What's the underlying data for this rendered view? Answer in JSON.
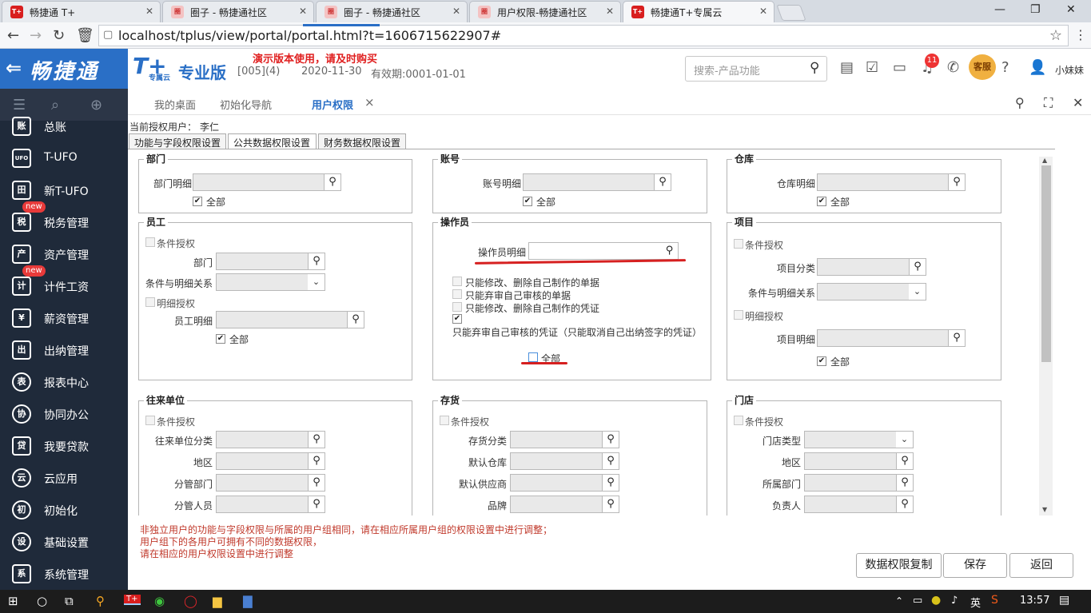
{
  "browser": {
    "tabs": [
      {
        "title": "畅捷通 T+",
        "fav": "T+"
      },
      {
        "title": "圈子 - 畅捷通社区",
        "fav": "圈"
      },
      {
        "title": "圈子 - 畅捷通社区",
        "fav": "圈"
      },
      {
        "title": "用户权限-畅捷通社区",
        "fav": "圈"
      },
      {
        "title": "畅捷通T+专属云",
        "fav": "T+"
      }
    ],
    "url": "localhost/tplus/view/portal/portal.html?t=1606715622907#"
  },
  "header": {
    "brand": "畅捷通",
    "logo": "T+",
    "logo_sub": "专属云",
    "edition": "专业版",
    "account": "[005](4)",
    "demo_notice": "演示版本使用，请及时购买",
    "date": "2020-11-30",
    "valid_until": "有效期:0001-01-01",
    "search_placeholder": "搜索-产品功能",
    "notification_count": "11",
    "mascot_text": "客服",
    "username": "小妹妹"
  },
  "sidebar": {
    "items": [
      {
        "label": "总账",
        "icon": "账"
      },
      {
        "label": "T-UFO",
        "icon": "UFO"
      },
      {
        "label": "新T-UFO",
        "icon": "田"
      },
      {
        "label": "税务管理",
        "icon": "税",
        "badge": "new"
      },
      {
        "label": "资产管理",
        "icon": "产"
      },
      {
        "label": "计件工资",
        "icon": "计",
        "badge": "new"
      },
      {
        "label": "薪资管理",
        "icon": "¥"
      },
      {
        "label": "出纳管理",
        "icon": "出"
      },
      {
        "label": "报表中心",
        "icon": "表"
      },
      {
        "label": "协同办公",
        "icon": "协"
      },
      {
        "label": "我要贷款",
        "icon": "贷"
      },
      {
        "label": "云应用",
        "icon": "云"
      },
      {
        "label": "初始化",
        "icon": "初"
      },
      {
        "label": "基础设置",
        "icon": "设"
      },
      {
        "label": "系统管理",
        "icon": "系"
      }
    ]
  },
  "worktabs": {
    "items": [
      "我的桌面",
      "初始化导航",
      "用户权限"
    ],
    "close": "×"
  },
  "page": {
    "current_user_label": "当前授权用户：",
    "current_user": "李仁",
    "tabs": [
      "功能与字段权限设置",
      "公共数据权限设置",
      "财务数据权限设置"
    ],
    "all": "全部",
    "cond_auth": "条件授权",
    "detail_auth": "明细授权",
    "dept": {
      "title": "部门",
      "detail": "部门明细"
    },
    "account": {
      "title": "账号",
      "detail": "账号明细"
    },
    "warehouse": {
      "title": "仓库",
      "detail": "仓库明细"
    },
    "employee": {
      "title": "员工",
      "dept": "部门",
      "relation": "条件与明细关系",
      "detail": "员工明细"
    },
    "operator": {
      "title": "操作员",
      "detail": "操作员明细",
      "opts": [
        "只能修改、删除自己制作的单据",
        "只能弃审自己审核的单据",
        "只能修改、删除自己制作的凭证",
        "只能弃审自己审核的凭证（只能取消自己出纳签字的凭证）"
      ]
    },
    "project": {
      "title": "项目",
      "category": "项目分类",
      "relation": "条件与明细关系",
      "detail": "项目明细"
    },
    "partner": {
      "title": "往来单位",
      "fields": [
        "往来单位分类",
        "地区",
        "分管部门",
        "分管人员"
      ]
    },
    "inventory": {
      "title": "存货",
      "fields": [
        "存货分类",
        "默认仓库",
        "默认供应商",
        "品牌"
      ]
    },
    "store": {
      "title": "门店",
      "fields": [
        "门店类型",
        "地区",
        "所属部门",
        "负责人"
      ]
    },
    "notes": [
      "非独立用户的功能与字段权限与所属的用户组相同，请在相应所属用户组的权限设置中进行调整；",
      "用户组下的各用户可拥有不同的数据权限，",
      "请在相应的用户权限设置中进行调整"
    ],
    "buttons": {
      "copy": "数据权限复制",
      "save": "保存",
      "back": "返回"
    }
  },
  "taskbar": {
    "ime": "英",
    "time": "13:57"
  }
}
